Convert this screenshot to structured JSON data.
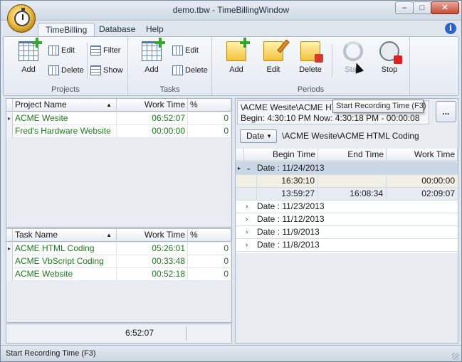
{
  "window": {
    "title": "demo.tbw - TimeBillingWindow",
    "controls": {
      "minimize": "–",
      "maximize": "□",
      "close": "✕"
    }
  },
  "tabs": [
    {
      "label": "TimeBilling",
      "active": true
    },
    {
      "label": "Database",
      "active": false
    },
    {
      "label": "Help",
      "active": false
    }
  ],
  "help_icon": "i",
  "ribbon": {
    "projects": {
      "label": "Projects",
      "add": "Add",
      "edit": "Edit",
      "delete": "Delete",
      "filter": "Filter",
      "show": "Show"
    },
    "tasks": {
      "label": "Tasks",
      "add": "Add",
      "edit": "Edit",
      "delete": "Delete"
    },
    "periods": {
      "label": "Periods",
      "add": "Add",
      "edit": "Edit",
      "delete": "Delete",
      "start": "Start",
      "stop": "Stop"
    }
  },
  "tooltip": "Start Recording Time (F3)",
  "projects_grid": {
    "headers": {
      "name": "Project Name",
      "sort": "▲",
      "work_time": "Work Time",
      "percent": "%"
    },
    "rows": [
      {
        "name": "ACME Wesite",
        "work_time": "06:52:07",
        "percent": "0"
      },
      {
        "name": "Fred's Hardware Website",
        "work_time": "00:00:00",
        "percent": "0"
      }
    ]
  },
  "tasks_grid": {
    "headers": {
      "name": "Task Name",
      "sort": "▲",
      "work_time": "Work Time",
      "percent": "%"
    },
    "rows": [
      {
        "name": "ACME HTML Coding",
        "work_time": "05:26:01",
        "percent": "0"
      },
      {
        "name": "ACME VbScript Coding",
        "work_time": "00:33:48",
        "percent": "0"
      },
      {
        "name": "ACME Website",
        "work_time": "00:52:18",
        "percent": "0"
      }
    ]
  },
  "left_footer_total": "6:52:07",
  "right": {
    "info_line1": "\\ACME Wesite\\ACME HTML Coding",
    "info_line2": "Begin: 4:30:10 PM Now: 4:30:18 PM - 00:00:08",
    "more_button": "...",
    "group_by": "Date",
    "path": "\\ACME Wesite\\ACME HTML Coding",
    "headers": {
      "begin": "Begin Time",
      "end": "End Time",
      "work": "Work Time"
    },
    "groups": [
      {
        "label": "Date : 11/24/2013",
        "expanded": true,
        "rows": [
          {
            "begin": "16:30:10",
            "end": "",
            "work": "00:00:00"
          },
          {
            "begin": "13:59:27",
            "end": "16:08:34",
            "work": "02:09:07"
          }
        ]
      },
      {
        "label": "Date : 11/23/2013",
        "expanded": false
      },
      {
        "label": "Date : 11/12/2013",
        "expanded": false
      },
      {
        "label": "Date : 11/9/2013",
        "expanded": false
      },
      {
        "label": "Date : 11/8/2013",
        "expanded": false
      }
    ]
  },
  "status_text": "Start Recording Time (F3)",
  "colors": {
    "accent_green": "#1f7a1f",
    "window_blue": "#dfe6ee",
    "stop_red": "#e11f1f"
  }
}
